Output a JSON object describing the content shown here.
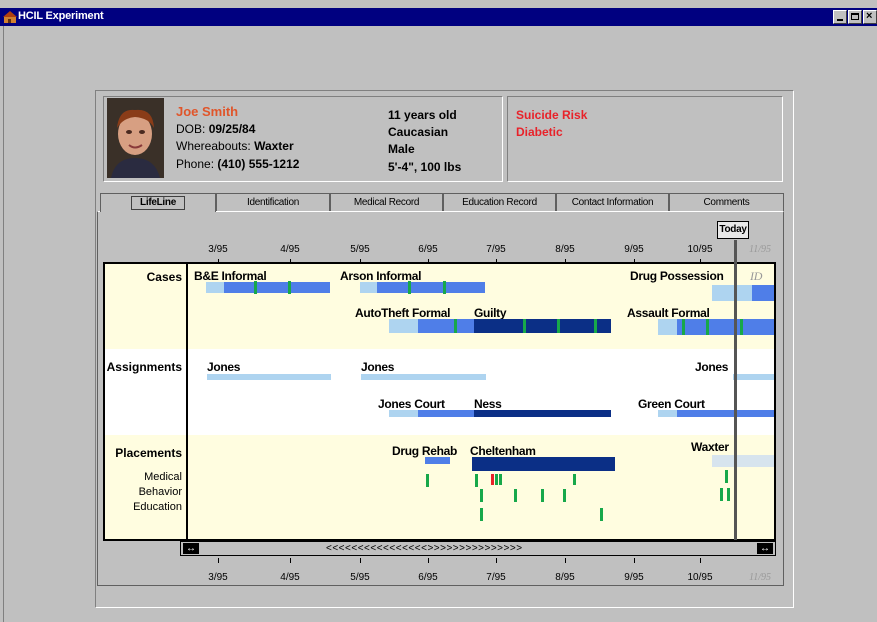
{
  "window": {
    "title": "HCIL Experiment"
  },
  "patient": {
    "name": "Joe Smith",
    "dob_label": "DOB:",
    "dob": "09/25/84",
    "whereabouts_label": "Whereabouts:",
    "whereabouts": "Waxter",
    "phone_label": "Phone:",
    "phone": "(410) 555-1212",
    "age": "11 years old",
    "race": "Caucasian",
    "sex": "Male",
    "build": "5'-4\", 100 lbs",
    "alerts": [
      "Suicide Risk",
      "Diabetic"
    ]
  },
  "tabs": [
    {
      "label": "LifeLine",
      "active": true
    },
    {
      "label": "Identification",
      "active": false
    },
    {
      "label": "Medical Record",
      "active": false
    },
    {
      "label": "Education Record",
      "active": false
    },
    {
      "label": "Contact Information",
      "active": false
    },
    {
      "label": "Comments",
      "active": false
    }
  ],
  "timeline": {
    "months": [
      "3/95",
      "4/95",
      "5/95",
      "6/95",
      "7/95",
      "8/95",
      "9/95",
      "10/95"
    ],
    "faded_month": "11/95",
    "today_label": "Today",
    "rows": {
      "cases": "Cases",
      "assignments": "Assignments",
      "placements": "Placements",
      "medical": "Medical",
      "behavior": "Behavior",
      "education": "Education"
    },
    "events": {
      "be_informal": "B&E Informal",
      "arson_informal": "Arson Informal",
      "drug_possession": "Drug Possession",
      "drug_possession_ghost": "ID",
      "autotheft_formal": "AutoTheft Formal",
      "guilty": "Guilty",
      "assault_formal": "Assault Formal",
      "jones_1": "Jones",
      "jones_2": "Jones",
      "jones_3": "Jones",
      "jones_court": "Jones Court",
      "ness": "Ness",
      "green_court": "Green Court",
      "drug_rehab": "Drug Rehab",
      "cheltenham": "Cheltenham",
      "waxter": "Waxter"
    },
    "scroll_glyphs": "<<<<<<<<<<<<<<<<>>>>>>>>>>>>>>>",
    "colors": {
      "light": "#aed4f0",
      "medium": "#4f7ee8",
      "dark": "#0b2f86",
      "mark": "#17a84a",
      "alert_mark": "#e8222a",
      "band": "#fffde0"
    }
  }
}
